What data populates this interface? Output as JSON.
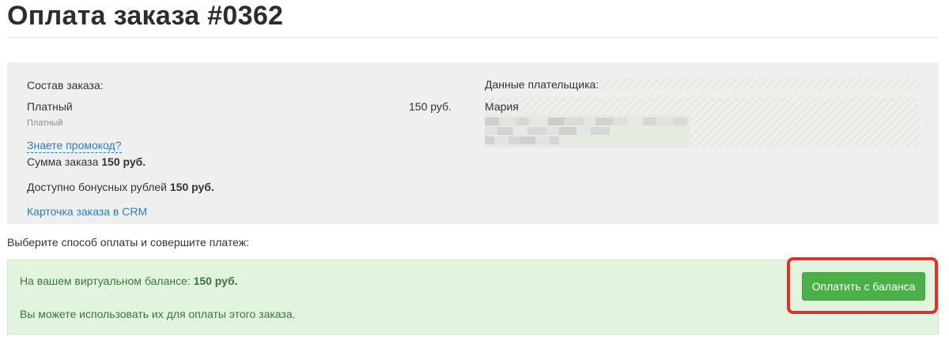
{
  "page": {
    "title": "Оплата заказа #0362"
  },
  "order": {
    "composition_label": "Состав заказа:",
    "item_name": "Платный",
    "item_subtitle": "Платный",
    "item_price": "150 руб.",
    "promo_link": "Знаете промокод?",
    "sum_label": "Сумма заказа",
    "sum_value": "150 руб.",
    "bonus_label": "Доступно бонусных рублей",
    "bonus_value": "150 руб.",
    "crm_link": "Карточка заказа в CRM"
  },
  "payer": {
    "label": "Данные плательщика:",
    "name": "Мария"
  },
  "payment": {
    "choose_text": "Выберите способ оплаты и совершите платеж:",
    "balance_text": "На вашем виртуальном балансе:",
    "balance_value": "150 руб.",
    "use_hint": "Вы можете использовать их для оплаты этого заказа.",
    "pay_button_label": "Оплатить с баланса"
  },
  "colors": {
    "accent_green": "#4cb049",
    "link_blue": "#2f7db8",
    "highlight_red": "#e0302b",
    "balance_bg": "#e3f4de"
  }
}
